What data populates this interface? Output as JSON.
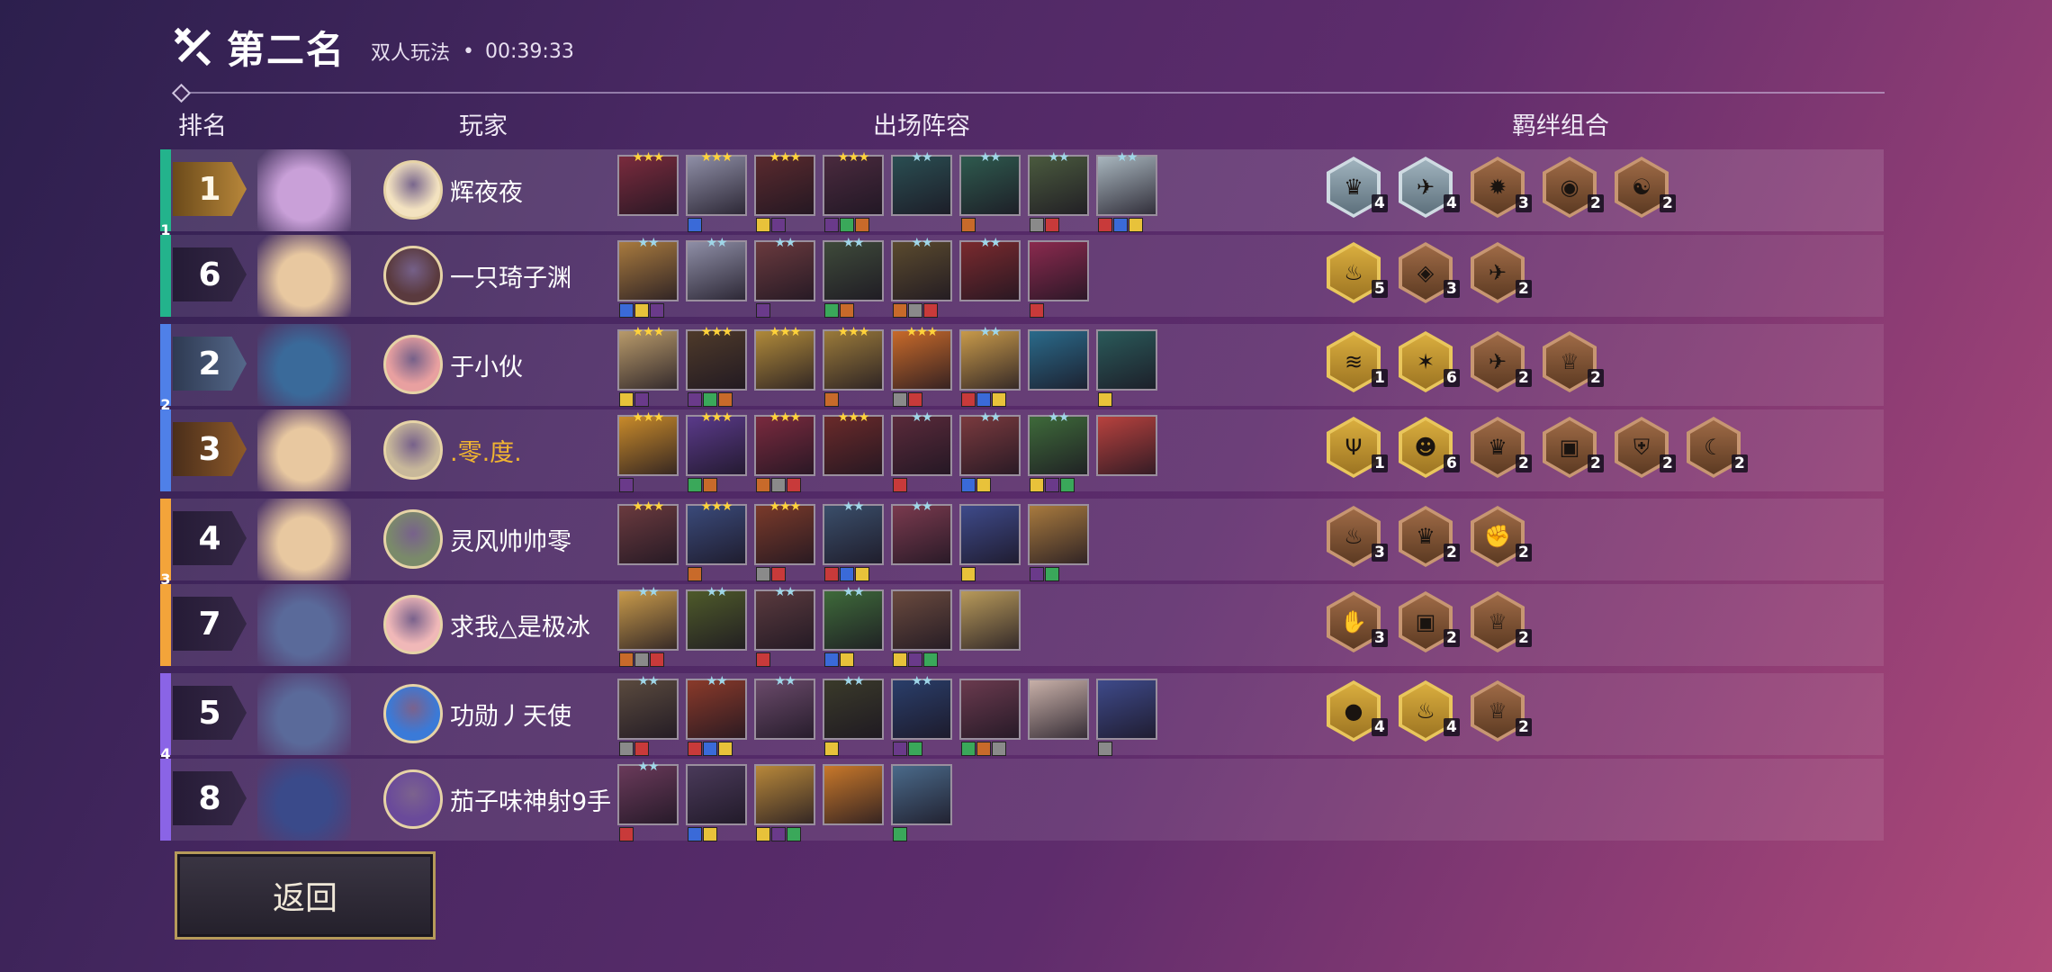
{
  "header": {
    "title": "第二名",
    "mode": "双人玩法",
    "separator": "•",
    "duration": "00:39:33"
  },
  "columns": {
    "rank": "排名",
    "player": "玩家",
    "lineup": "出场阵容",
    "traits": "羁绊组合"
  },
  "colors": {
    "team1": "#23b38c",
    "team2": "#4f80e8",
    "team3": "#f3a43a",
    "team4": "#8a64e6",
    "accent_gold": "#f2b530"
  },
  "rows": [
    {
      "team": "1",
      "rank": "1",
      "rank_style": "top",
      "name": "辉夜夜",
      "name_gold": false,
      "champs": [
        {
          "stars": "★★★",
          "tier": "g",
          "c": "#7a2b3d"
        },
        {
          "stars": "★★★",
          "tier": "g",
          "c": "#8e8ea6"
        },
        {
          "stars": "★★★",
          "tier": "g",
          "c": "#5a2a2e"
        },
        {
          "stars": "★★★",
          "tier": "g",
          "c": "#4a2a3e"
        },
        {
          "stars": "★★",
          "tier": "s",
          "c": "#2a4e52"
        },
        {
          "stars": "★★",
          "tier": "s",
          "c": "#2e5a4e"
        },
        {
          "stars": "★★",
          "tier": "s",
          "c": "#4a5a3e"
        },
        {
          "stars": "★★",
          "tier": "s",
          "c": "#a8b6be"
        }
      ],
      "traits": [
        {
          "tier": "silver",
          "icon": "♛",
          "count": "4"
        },
        {
          "tier": "silver",
          "icon": "✈",
          "count": "4"
        },
        {
          "tier": "bronze",
          "icon": "✹",
          "count": "3"
        },
        {
          "tier": "bronze",
          "icon": "◉",
          "count": "2"
        },
        {
          "tier": "bronze",
          "icon": "☯",
          "count": "2"
        }
      ]
    },
    {
      "team": "1",
      "rank": "6",
      "rank_style": "",
      "name": "一只琦子渊",
      "name_gold": false,
      "champs": [
        {
          "stars": "★★",
          "tier": "s",
          "c": "#a87a3e"
        },
        {
          "stars": "★★",
          "tier": "s",
          "c": "#8e8ea6"
        },
        {
          "stars": "★★",
          "tier": "s",
          "c": "#6a3a3e"
        },
        {
          "stars": "★★",
          "tier": "s",
          "c": "#3e4a3a"
        },
        {
          "stars": "★★",
          "tier": "s",
          "c": "#5a4a2e"
        },
        {
          "stars": "★★",
          "tier": "s",
          "c": "#7a2a2e"
        },
        {
          "stars": "",
          "tier": "s",
          "c": "#8a2a4e"
        }
      ],
      "traits": [
        {
          "tier": "gold",
          "icon": "♨",
          "count": "5"
        },
        {
          "tier": "bronze",
          "icon": "◈",
          "count": "3"
        },
        {
          "tier": "bronze",
          "icon": "✈",
          "count": "2"
        }
      ]
    },
    {
      "team": "2",
      "rank": "2",
      "rank_style": "blue",
      "name": "于小伙",
      "name_gold": false,
      "champs": [
        {
          "stars": "★★★",
          "tier": "g",
          "c": "#b89a6a"
        },
        {
          "stars": "★★★",
          "tier": "g",
          "c": "#4e3a2a"
        },
        {
          "stars": "★★★",
          "tier": "g",
          "c": "#b08a3a"
        },
        {
          "stars": "★★★",
          "tier": "g",
          "c": "#9a7a3a"
        },
        {
          "stars": "★★★",
          "tier": "g",
          "c": "#c86a2a"
        },
        {
          "stars": "★★",
          "tier": "s",
          "c": "#c89a4a"
        },
        {
          "stars": "",
          "tier": "s",
          "c": "#2a6a8a"
        },
        {
          "stars": "",
          "tier": "s",
          "c": "#2a5a5a"
        }
      ],
      "traits": [
        {
          "tier": "gold",
          "icon": "≋",
          "count": "1"
        },
        {
          "tier": "gold",
          "icon": "✶",
          "count": "6"
        },
        {
          "tier": "bronze",
          "icon": "✈",
          "count": "2"
        },
        {
          "tier": "bronze",
          "icon": "♕",
          "count": "2"
        }
      ]
    },
    {
      "team": "2",
      "rank": "3",
      "rank_style": "orange",
      "name": ".零.度.",
      "name_gold": true,
      "champs": [
        {
          "stars": "★★★",
          "tier": "g",
          "c": "#c88a2a"
        },
        {
          "stars": "★★★",
          "tier": "g",
          "c": "#5a3a8a"
        },
        {
          "stars": "★★★",
          "tier": "g",
          "c": "#7a2a3e"
        },
        {
          "stars": "★★★",
          "tier": "g",
          "c": "#6a2a2a"
        },
        {
          "stars": "★★",
          "tier": "s",
          "c": "#5a2a3a"
        },
        {
          "stars": "★★",
          "tier": "s",
          "c": "#7a3a3e"
        },
        {
          "stars": "★★",
          "tier": "s",
          "c": "#3e6a3a"
        },
        {
          "stars": "",
          "tier": "s",
          "c": "#b8423e"
        }
      ],
      "traits": [
        {
          "tier": "gold",
          "icon": "Ψ",
          "count": "1"
        },
        {
          "tier": "gold",
          "icon": "☻",
          "count": "6"
        },
        {
          "tier": "bronze",
          "icon": "♛",
          "count": "2"
        },
        {
          "tier": "bronze",
          "icon": "▣",
          "count": "2"
        },
        {
          "tier": "bronze",
          "icon": "⛨",
          "count": "2"
        },
        {
          "tier": "bronze",
          "icon": "☾",
          "count": "2"
        }
      ]
    },
    {
      "team": "3",
      "rank": "4",
      "rank_style": "",
      "name": "灵风帅帅零",
      "name_gold": false,
      "champs": [
        {
          "stars": "★★★",
          "tier": "g",
          "c": "#6a3a3e"
        },
        {
          "stars": "★★★",
          "tier": "g",
          "c": "#3a4a7a"
        },
        {
          "stars": "★★★",
          "tier": "g",
          "c": "#7a3a2a"
        },
        {
          "stars": "★★",
          "tier": "s",
          "c": "#3a4e6a"
        },
        {
          "stars": "★★",
          "tier": "s",
          "c": "#7a3a4e"
        },
        {
          "stars": "",
          "tier": "s",
          "c": "#3e4a8a"
        },
        {
          "stars": "",
          "tier": "s",
          "c": "#a87a3e"
        }
      ],
      "traits": [
        {
          "tier": "bronze",
          "icon": "♨",
          "count": "3"
        },
        {
          "tier": "bronze",
          "icon": "♛",
          "count": "2"
        },
        {
          "tier": "bronze",
          "icon": "✊",
          "count": "2"
        }
      ]
    },
    {
      "team": "3",
      "rank": "7",
      "rank_style": "",
      "name": "求我△是极冰",
      "name_gold": false,
      "champs": [
        {
          "stars": "★★",
          "tier": "s",
          "c": "#c89a4a"
        },
        {
          "stars": "★★",
          "tier": "s",
          "c": "#4e5a2a"
        },
        {
          "stars": "★★",
          "tier": "s",
          "c": "#5a3a3e"
        },
        {
          "stars": "★★",
          "tier": "s",
          "c": "#3e6a3a"
        },
        {
          "stars": "",
          "tier": "s",
          "c": "#6a4a3e"
        },
        {
          "stars": "",
          "tier": "s",
          "c": "#b89a5a"
        }
      ],
      "traits": [
        {
          "tier": "bronze",
          "icon": "✋",
          "count": "3"
        },
        {
          "tier": "bronze",
          "icon": "▣",
          "count": "2"
        },
        {
          "tier": "bronze",
          "icon": "♕",
          "count": "2"
        }
      ]
    },
    {
      "team": "4",
      "rank": "5",
      "rank_style": "",
      "name": "功勋丿天使",
      "name_gold": false,
      "champs": [
        {
          "stars": "★★",
          "tier": "s",
          "c": "#5a4a3e"
        },
        {
          "stars": "★★",
          "tier": "s",
          "c": "#8a3a2a"
        },
        {
          "stars": "★★",
          "tier": "s",
          "c": "#6a4a6a"
        },
        {
          "stars": "★★",
          "tier": "s",
          "c": "#3a3a2a"
        },
        {
          "stars": "★★",
          "tier": "s",
          "c": "#2a3e6a"
        },
        {
          "stars": "",
          "tier": "s",
          "c": "#6a3a4e"
        },
        {
          "stars": "",
          "tier": "s",
          "c": "#c8b0a8"
        },
        {
          "stars": "",
          "tier": "s",
          "c": "#3e4a8a"
        }
      ],
      "traits": [
        {
          "tier": "gold",
          "icon": "●",
          "count": "4"
        },
        {
          "tier": "gold",
          "icon": "♨",
          "count": "4"
        },
        {
          "tier": "bronze",
          "icon": "♕",
          "count": "2"
        }
      ]
    },
    {
      "team": "4",
      "rank": "8",
      "rank_style": "",
      "name": "茄子味神射9手",
      "name_gold": false,
      "champs": [
        {
          "stars": "★★",
          "tier": "s",
          "c": "#6a3a5a"
        },
        {
          "stars": "",
          "tier": "s",
          "c": "#4a3a5a"
        },
        {
          "stars": "",
          "tier": "s",
          "c": "#b8883a"
        },
        {
          "stars": "",
          "tier": "s",
          "c": "#c8782a"
        },
        {
          "stars": "",
          "tier": "s",
          "c": "#4a6a8a"
        }
      ],
      "traits": []
    }
  ],
  "back_label": "返回"
}
